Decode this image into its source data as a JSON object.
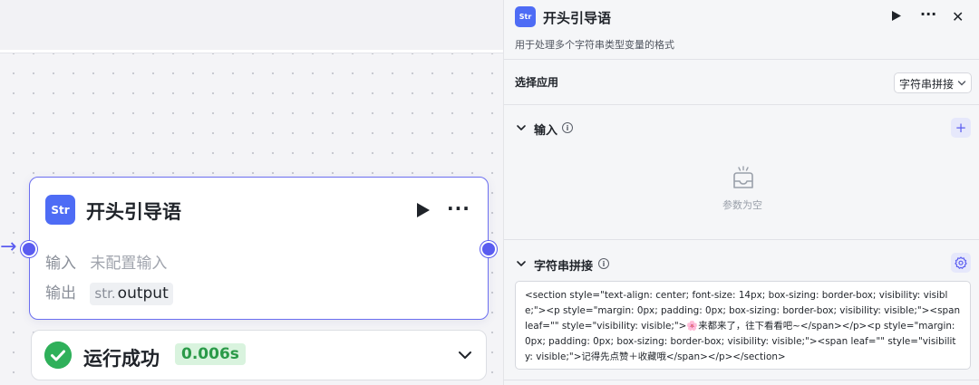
{
  "node": {
    "icon_text": "Str",
    "title": "开头引导语",
    "more": "···",
    "input_label": "输入",
    "input_value": "未配置输入",
    "output_label": "输出",
    "output_type": "str.",
    "output_name": "output"
  },
  "run_status": {
    "text": "运行成功",
    "time": "0.006s"
  },
  "panel": {
    "icon_text": "Str",
    "title": "开头引导语",
    "more": "···",
    "close": "✕",
    "description": "用于处理多个字符串类型变量的格式",
    "select_app": {
      "label": "选择应用",
      "selected": "字符串拼接"
    },
    "input_section": {
      "title": "输入",
      "add": "+",
      "empty_text": "参数为空"
    },
    "concat_section": {
      "title": "字符串拼接",
      "content": "<section style=\"text-align: center; font-size: 14px; box-sizing: border-box; visibility: visible;\"><p style=\"margin: 0px; padding: 0px; box-sizing: border-box; visibility: visible;\"><span leaf=\"\" style=\"visibility: visible;\">🌸来都来了，往下看看吧~</span></p><p style=\"margin: 0px; padding: 0px; box-sizing: border-box; visibility: visible;\"><span leaf=\"\" style=\"visibility: visible;\">记得先点赞＋收藏哦</span></p></section>"
    }
  },
  "colors": {
    "accent": "#5a5cf0",
    "node_icon": "#4e6cf5",
    "success": "#2fb05a"
  }
}
